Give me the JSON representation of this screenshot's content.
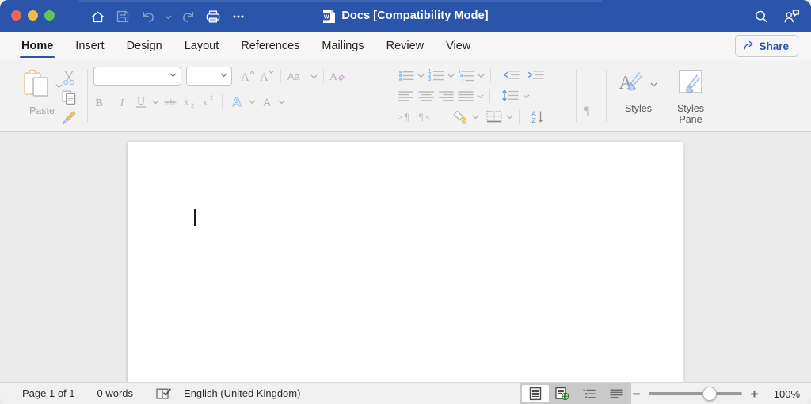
{
  "window": {
    "title": "Docs [Compatibility Mode]",
    "accent_color": "#2b55ab",
    "titlebar_color": "#2b55ab",
    "traffic_lights": [
      "close",
      "minimize",
      "zoom"
    ]
  },
  "quick_access": {
    "items": [
      {
        "name": "home-icon",
        "label": "Home",
        "enabled": true
      },
      {
        "name": "save-icon",
        "label": "Save",
        "enabled": false
      },
      {
        "name": "undo-icon",
        "label": "Undo",
        "enabled": false
      },
      {
        "name": "undo-dropdown-icon",
        "label": "Undo options",
        "enabled": false
      },
      {
        "name": "redo-icon",
        "label": "Redo",
        "enabled": false
      },
      {
        "name": "print-icon",
        "label": "Print",
        "enabled": true
      },
      {
        "name": "more-icon",
        "label": "More",
        "enabled": true
      }
    ]
  },
  "titlebar_right": {
    "search_label": "Search",
    "collaborate_label": "Collaborate"
  },
  "ribbon_tabs": {
    "items": [
      {
        "label": "Home",
        "active": true
      },
      {
        "label": "Insert",
        "active": false
      },
      {
        "label": "Design",
        "active": false
      },
      {
        "label": "Layout",
        "active": false
      },
      {
        "label": "References",
        "active": false
      },
      {
        "label": "Mailings",
        "active": false
      },
      {
        "label": "Review",
        "active": false
      },
      {
        "label": "View",
        "active": false
      }
    ],
    "share_label": "Share"
  },
  "ribbon": {
    "clipboard": {
      "paste_label": "Paste",
      "cut_label": "Cut",
      "copy_label": "Copy",
      "format_painter_label": "Format Painter"
    },
    "font": {
      "font_name_value": "",
      "font_name_placeholder": "",
      "font_size_value": "",
      "font_size_placeholder": "",
      "grow_font_label": "Grow Font",
      "shrink_font_label": "Shrink Font",
      "change_case_label": "Change Case",
      "clear_formatting_label": "Clear Formatting",
      "bold_label": "Bold",
      "italic_label": "Italic",
      "underline_label": "Underline",
      "strikethrough_label": "Strikethrough",
      "subscript_label": "Subscript",
      "superscript_label": "Superscript",
      "text_effects_label": "Text Effects",
      "font_color_label": "Font Color"
    },
    "paragraph": {
      "bullets_label": "Bullets",
      "numbering_label": "Numbering",
      "multilevel_list_label": "Multilevel List",
      "decrease_indent_label": "Decrease Indent",
      "increase_indent_label": "Increase Indent",
      "align_left_label": "Align Left",
      "align_center_label": "Center",
      "align_right_label": "Align Right",
      "justify_label": "Justify",
      "line_spacing_label": "Line Spacing",
      "ltr_label": "Left-to-Right Text Direction",
      "rtl_label": "Right-to-Left Text Direction",
      "shading_label": "Shading",
      "borders_label": "Borders",
      "sort_label": "Sort"
    },
    "styles": {
      "styles_label": "Styles",
      "styles_pane_label": "Styles\nPane",
      "styles_pane_line1": "Styles",
      "styles_pane_line2": "Pane"
    }
  },
  "document": {
    "content": "",
    "cursor_visible": true
  },
  "status_bar": {
    "page_count": "Page 1 of 1",
    "word_count": "0 words",
    "proofing_label": "Proofing",
    "language": "English (United Kingdom)",
    "views": [
      {
        "name": "print-layout",
        "label": "Print Layout",
        "selected": true
      },
      {
        "name": "web-layout",
        "label": "Web Layout",
        "selected": false
      },
      {
        "name": "outline",
        "label": "Outline",
        "selected": false
      },
      {
        "name": "draft",
        "label": "Draft",
        "selected": false
      }
    ],
    "zoom_out_label": "−",
    "zoom_in_label": "+",
    "zoom_level": "100%",
    "zoom_value": 100
  }
}
